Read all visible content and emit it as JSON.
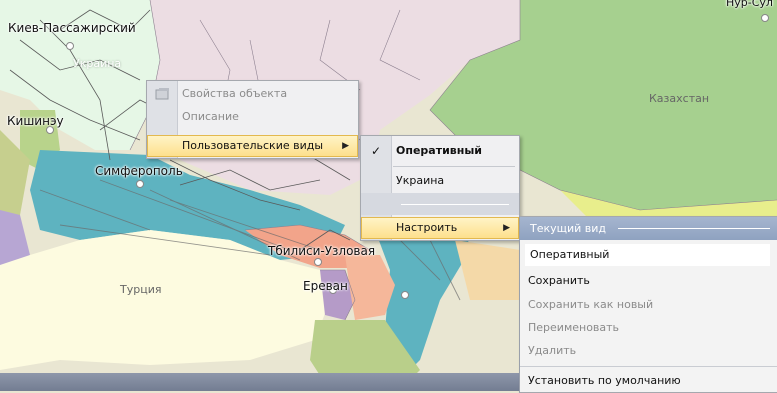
{
  "map": {
    "cities": [
      "Киев-Пассажирский",
      "Кишинэу",
      "Симферополь",
      "Тбилиси-Узловая",
      "Ереван",
      "Нур-Сул"
    ],
    "countries": [
      "Украина",
      "Казахстан",
      "Турция"
    ]
  },
  "colors": {
    "kazakhstan": "#a6d08f",
    "ukraine": "#e6f7e6",
    "sea": "#5eb3c0",
    "turkey": "#fdfbe0",
    "russia": "#ecdde3",
    "menu_highlight": "#fde08d",
    "submenu_header": "#98a9c6"
  },
  "context_menu": {
    "items": [
      {
        "label": "Свойства объекта",
        "icon": "properties-icon",
        "enabled": false
      },
      {
        "label": "Описание",
        "enabled": false
      },
      {
        "label": "Пользовательские виды",
        "submenu": true,
        "highlighted": true
      }
    ]
  },
  "views_menu": {
    "items": [
      {
        "label": "Оперативный",
        "checked": true,
        "bold": true
      },
      {
        "label": "Украина"
      },
      {
        "label": ""
      },
      {
        "label": "Настроить",
        "submenu": true,
        "highlighted": true
      }
    ]
  },
  "configure_menu": {
    "header": "Текущий вид",
    "current_view": "Оперативный",
    "items": [
      {
        "label": "Сохранить",
        "enabled": true
      },
      {
        "label": "Сохранить как новый",
        "enabled": false
      },
      {
        "label": "Переименовать",
        "enabled": false
      },
      {
        "label": "Удалить",
        "enabled": false
      },
      {
        "label": "Установить по умолчанию",
        "enabled": true
      }
    ]
  }
}
